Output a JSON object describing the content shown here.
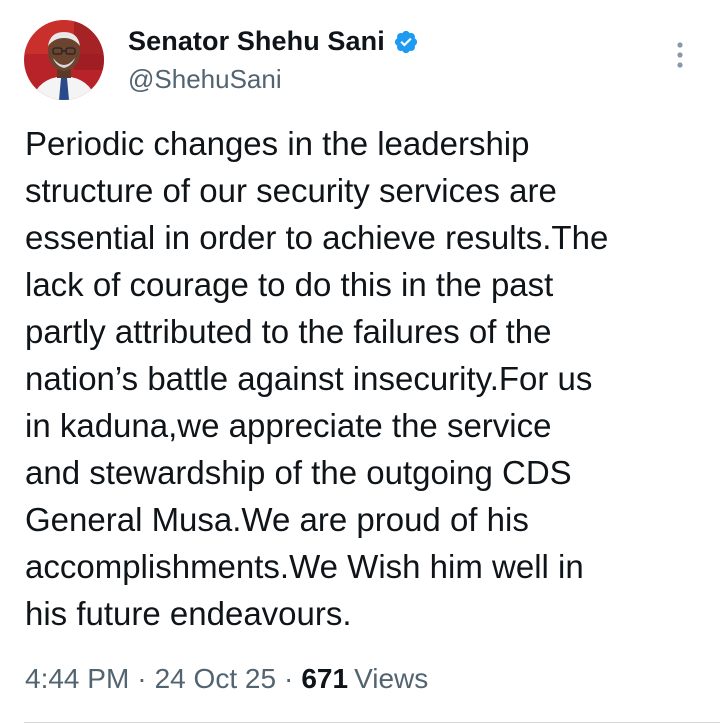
{
  "author": {
    "display_name": "Senator Shehu Sani",
    "handle": "@ShehuSani",
    "verified_icon": "verified-badge-icon",
    "verified_color": "#1d9bf0"
  },
  "tweet": {
    "text": "Periodic changes in the leadership\nstructure of our security services are\nessential in order to achieve results.The\nlack of courage to do this in the past\npartly attributed to the failures of the\nnation’s battle against insecurity.For us\nin kaduna,we appreciate the service\nand stewardship of the outgoing CDS\nGeneral Musa.We are proud of his\naccomplishments.We Wish him well in\nhis future endeavours."
  },
  "meta": {
    "time": "4:44 PM",
    "separator": "·",
    "date": "24 Oct 25",
    "views_count": "671",
    "views_label": "Views"
  },
  "colors": {
    "text_primary": "#0f1419",
    "text_secondary": "#536471",
    "divider": "#cfd9de"
  }
}
